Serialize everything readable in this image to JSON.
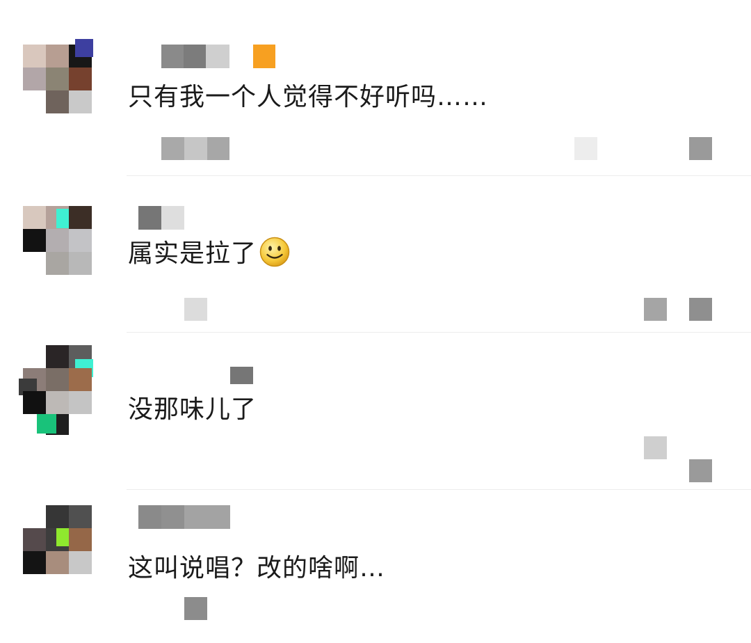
{
  "comments": [
    {
      "text": "只有我一个人觉得不好听吗……",
      "emoji": ""
    },
    {
      "text": "属实是拉了",
      "emoji": "smile-emoji"
    },
    {
      "text": "没那味儿了",
      "emoji": ""
    },
    {
      "text": "这叫说唱？改的啥啊…",
      "emoji": ""
    }
  ],
  "colors": {
    "text": "#1a1a1a",
    "divider": "#ececec",
    "mosaic_gray": "#9a9a9a",
    "badge_orange": "#f7a021"
  }
}
